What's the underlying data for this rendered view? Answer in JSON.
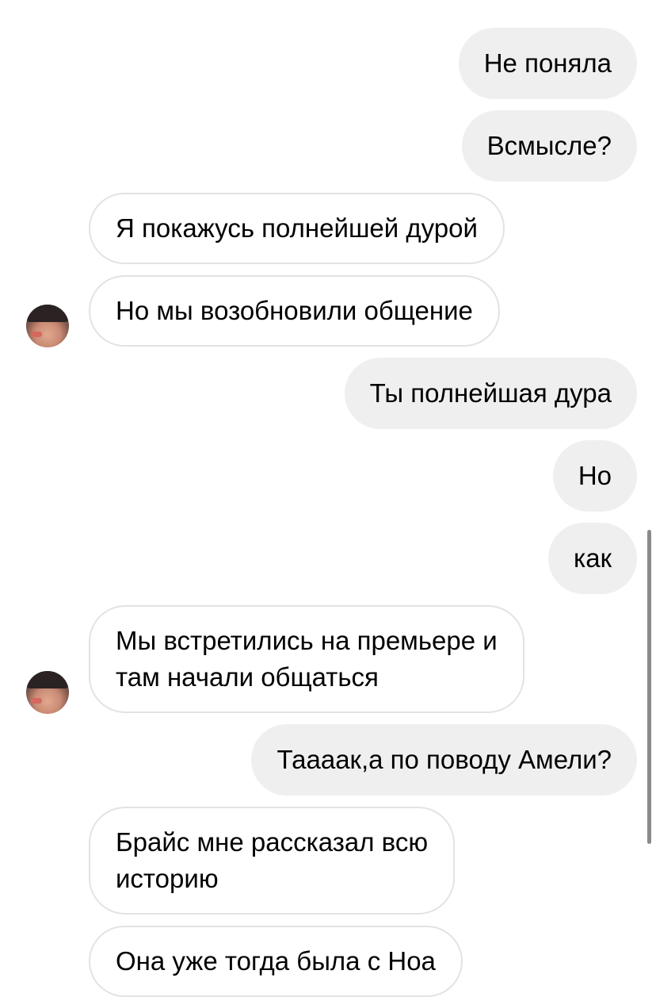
{
  "colors": {
    "outgoing_bubble": "#efeff0",
    "incoming_border": "#e3e3e6",
    "text": "#000000"
  },
  "messages": [
    {
      "direction": "outgoing",
      "text": "Не поняла"
    },
    {
      "direction": "outgoing",
      "text": "Всмысле?"
    },
    {
      "direction": "incoming",
      "text": "Я покажусь полнейшей дурой"
    },
    {
      "direction": "incoming",
      "text": "Но мы возобновили общение"
    },
    {
      "direction": "outgoing",
      "text": "Ты полнейшая дура"
    },
    {
      "direction": "outgoing",
      "text": "Но"
    },
    {
      "direction": "outgoing",
      "text": "как"
    },
    {
      "direction": "incoming",
      "text": "Мы встретились на премьере и\nтам начали общаться"
    },
    {
      "direction": "outgoing",
      "text": "Таааак,а по поводу Амели?"
    },
    {
      "direction": "incoming",
      "text": "Брайс мне рассказал всю\nисторию"
    },
    {
      "direction": "incoming",
      "text": "Она уже тогда была с Ноа"
    }
  ]
}
